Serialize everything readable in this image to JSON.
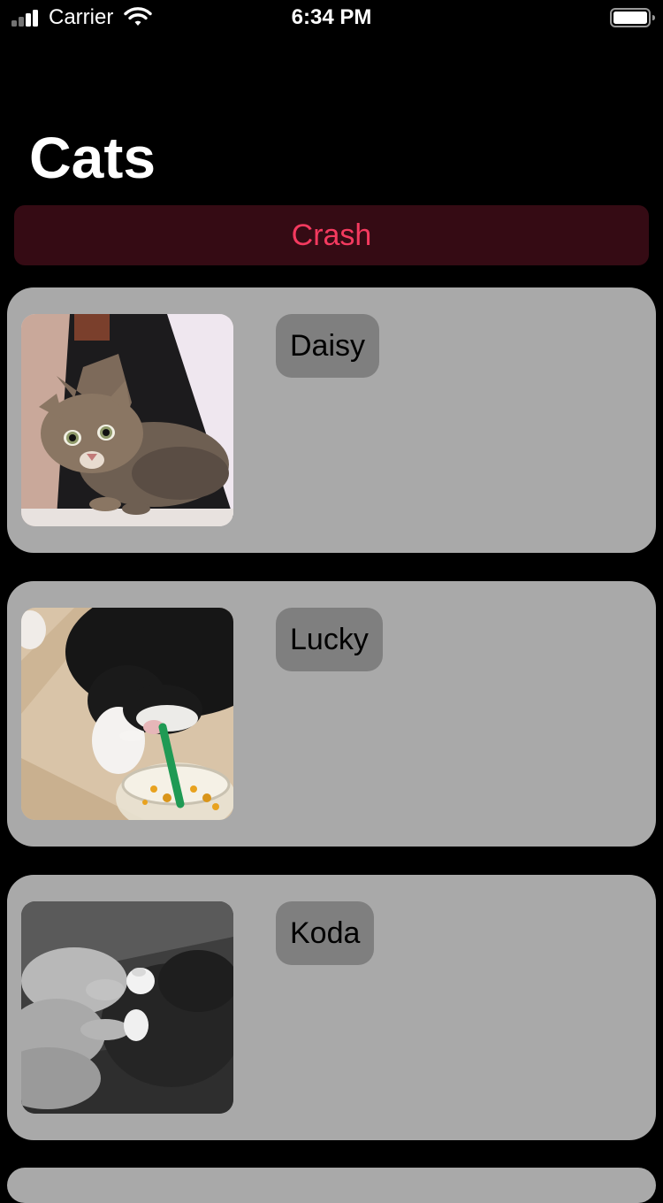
{
  "status_bar": {
    "carrier": "Carrier",
    "time": "6:34 PM",
    "icons": [
      "signal-icon",
      "wifi-icon",
      "battery-icon"
    ]
  },
  "page": {
    "title": "Cats"
  },
  "crash_button": {
    "label": "Crash",
    "text_color": "#f43a5f",
    "background": "#350b14"
  },
  "cats": [
    {
      "name": "Daisy",
      "photo": "tabby cat looking up"
    },
    {
      "name": "Lucky",
      "photo": "black and white cat sniffing drink straw"
    },
    {
      "name": "Koda",
      "photo": "black and white photo of hands holding a kitten's paws"
    }
  ],
  "colors": {
    "background": "#000000",
    "card": "#a9a9a9",
    "badge": "#7f7f7f"
  }
}
